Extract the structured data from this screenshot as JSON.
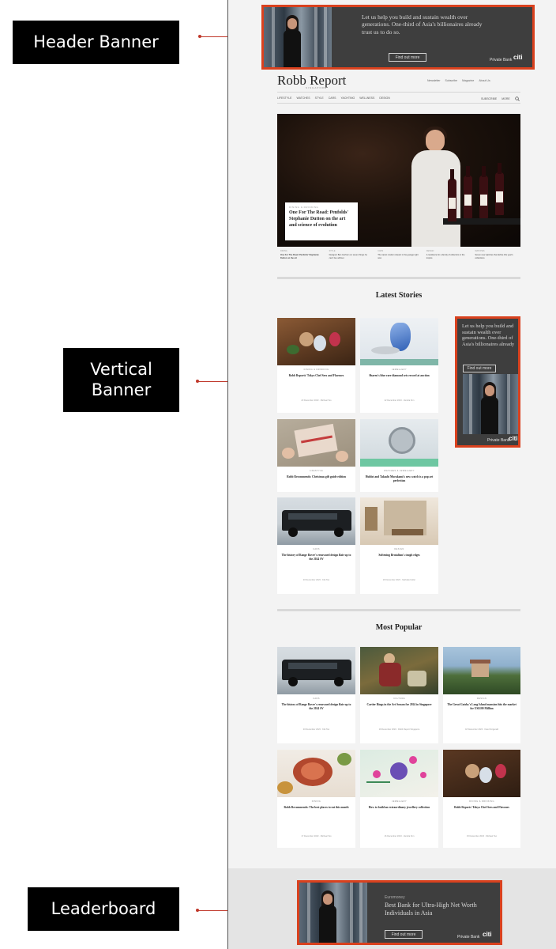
{
  "annotations": {
    "header_banner": "Header Banner",
    "vertical_banner": "Vertical Banner",
    "leaderboard": "Leaderboard"
  },
  "header_ad": {
    "headline": "Let us help you build and sustain wealth over generations. One-third of Asia's billionaires already trust us to do so.",
    "button": "Find out more",
    "brand": "Private Bank",
    "logo": "citi"
  },
  "site": {
    "masthead": "Robb Report",
    "masthead_sub": "SINGAPORE",
    "top_links": [
      "Newsletter",
      "Subscribe",
      "Magazine",
      "About Us"
    ],
    "nav": [
      "LIFESTYLE",
      "WATCHES",
      "STYLE",
      "CARS",
      "YACHTING",
      "WELLNESS",
      "DESIGN"
    ],
    "nav_right": [
      "SUBSCRIBE",
      "MORE"
    ],
    "search_icon": "search-icon"
  },
  "hero": {
    "kicker": "DINING & DRINKING",
    "title": "One For The Road: Penfolds' Stephanie Dutton on the art and science of evolution"
  },
  "featured_strip": [
    {
      "kicker": "DINING",
      "title": "One For The Road: Penfolds' Stephanie Dutton on the art"
    },
    {
      "kicker": "STYLE",
      "title": "Designer Ben Gorham on seven things he can't live without"
    },
    {
      "kicker": "CARS",
      "title": "The rarest modern classic in the garage right now"
    },
    {
      "kicker": "DESIGN",
      "title": "A residence for a family of collectors in the tropics"
    },
    {
      "kicker": "WATCHES",
      "title": "Seven new watches that define this year's collections"
    }
  ],
  "latest": {
    "title": "Latest Stories",
    "cards": [
      {
        "cat": "DINING & DRINKING",
        "title": "Robb Reports' Tokyo Chef Sees and Flavours",
        "meta": "23 December 2023 · Michael Teo"
      },
      {
        "cat": "JEWELLERY",
        "title": "Sharen's blue rare diamond sets record at auction",
        "meta": "22 December 2023 · Zandra Kim"
      },
      {
        "cat": "LIFESTYLE",
        "title": "Robb Recommends: Christmas gift guide edition",
        "meta": "21 December 2023 · Zandra Kim"
      },
      {
        "cat": "WATCHES & JEWELLERY",
        "title": "Hublot and Takashi Murakami's new watch is a pop art perfection",
        "meta": "21 December 2023 · Michael Teo"
      },
      {
        "cat": "CARS",
        "title": "The history of Range Rover's renowned design flair up to the 2024 SV",
        "meta": "20 December 2023 · Kiki Tan"
      },
      {
        "cat": "DESIGN",
        "title": "Softening Brutalism's tough edges",
        "meta": "20 December 2023 · Nathalie Keller"
      }
    ]
  },
  "vertical_ad": {
    "headline": "Let us help you build and sustain wealth over generations. One-third of Asia's billionaires already",
    "button": "Find out more",
    "brand": "Private Bank",
    "logo": "citi"
  },
  "popular": {
    "title": "Most Popular",
    "cards": [
      {
        "cat": "CARS",
        "title": "The history of Range Rover's renowned design flair up to the 2024 SV",
        "meta": "20 December 2023 · Kiki Tan"
      },
      {
        "cat": "CULTURE",
        "title": "Cartier Rings in the Art Season for 2024 in Singapore",
        "meta": "19 December 2023 · Robb Report Singapore"
      },
      {
        "cat": "DESIGN",
        "title": "The Great Gatsby's Long Island mansion hits the market for US$100 Million",
        "meta": "18 December 2023 · Kate Fitzgerald"
      },
      {
        "cat": "DINING",
        "title": "Robb Recommends: The best places to eat this month",
        "meta": "17 December 2023 · Michael Teo"
      },
      {
        "cat": "JEWELLERY",
        "title": "How to build an extraordinary jewellery collection",
        "meta": "16 December 2023 · Zandra Kim"
      },
      {
        "cat": "DINING & DRINKING",
        "title": "Robb Reports' Tokyo Chef Sees and Flavours",
        "meta": "15 December 2023 · Michael Teo"
      }
    ]
  },
  "leaderboard_ad": {
    "kicker": "Euromoney",
    "headline": "Best Bank for Ultra-High Net Worth Individuals in Asia",
    "button": "Find out more",
    "brand": "Private Bank",
    "logo": "citi"
  },
  "colors": {
    "annotation_red": "#d9411e",
    "annotation_label_bg": "#000000",
    "ad_bg": "#3e3e3e"
  }
}
